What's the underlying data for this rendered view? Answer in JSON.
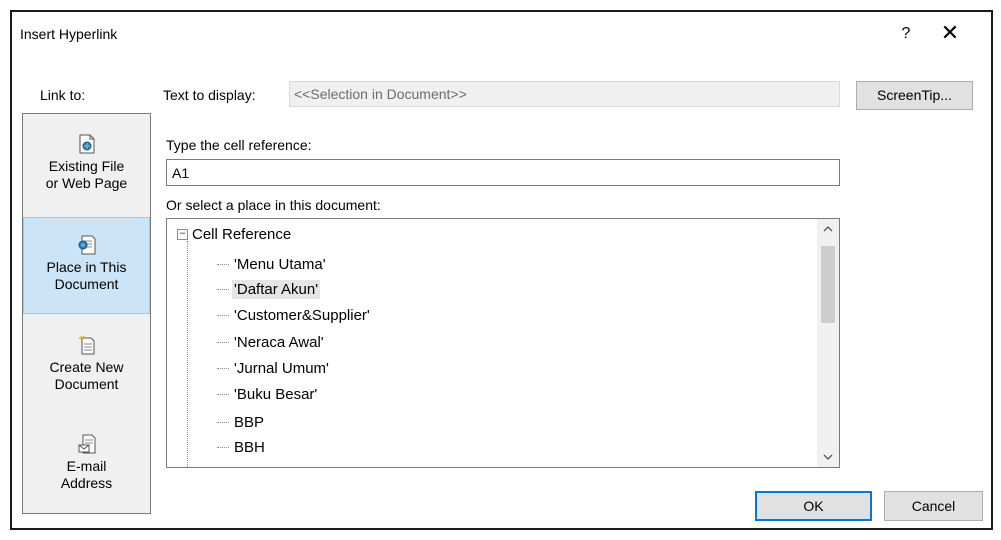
{
  "dialog": {
    "title": "Insert Hyperlink",
    "help_label": "?",
    "close_label": "✕"
  },
  "link_to": {
    "label": "Link to:",
    "items": [
      {
        "label": "Existing File\nor Web Page",
        "icon": "existing-file-icon",
        "selected": false
      },
      {
        "label": "Place in This\nDocument",
        "icon": "place-in-document-icon",
        "selected": true
      },
      {
        "label": "Create New\nDocument",
        "icon": "new-document-icon",
        "selected": false
      },
      {
        "label": "E-mail\nAddress",
        "icon": "email-icon",
        "selected": false
      }
    ]
  },
  "text_to_display": {
    "label": "Text to display:",
    "value": "<<Selection in Document>>"
  },
  "screentip_label": "ScreenTip...",
  "cell_reference": {
    "label": "Type the cell reference:",
    "value": "A1"
  },
  "place": {
    "label": "Or select a place in this document:",
    "root_label": "Cell Reference",
    "expander": "−",
    "items": [
      "'Menu Utama'",
      "'Daftar Akun'",
      "'Customer&Supplier'",
      "'Neraca Awal'",
      "'Jurnal Umum'",
      "'Buku Besar'",
      "BBP",
      "BBH"
    ],
    "highlighted_item": "'Daftar Akun'"
  },
  "buttons": {
    "ok": "OK",
    "cancel": "Cancel"
  },
  "colors": {
    "selection": "#cce4f7",
    "default_button_border": "#0078d7"
  }
}
